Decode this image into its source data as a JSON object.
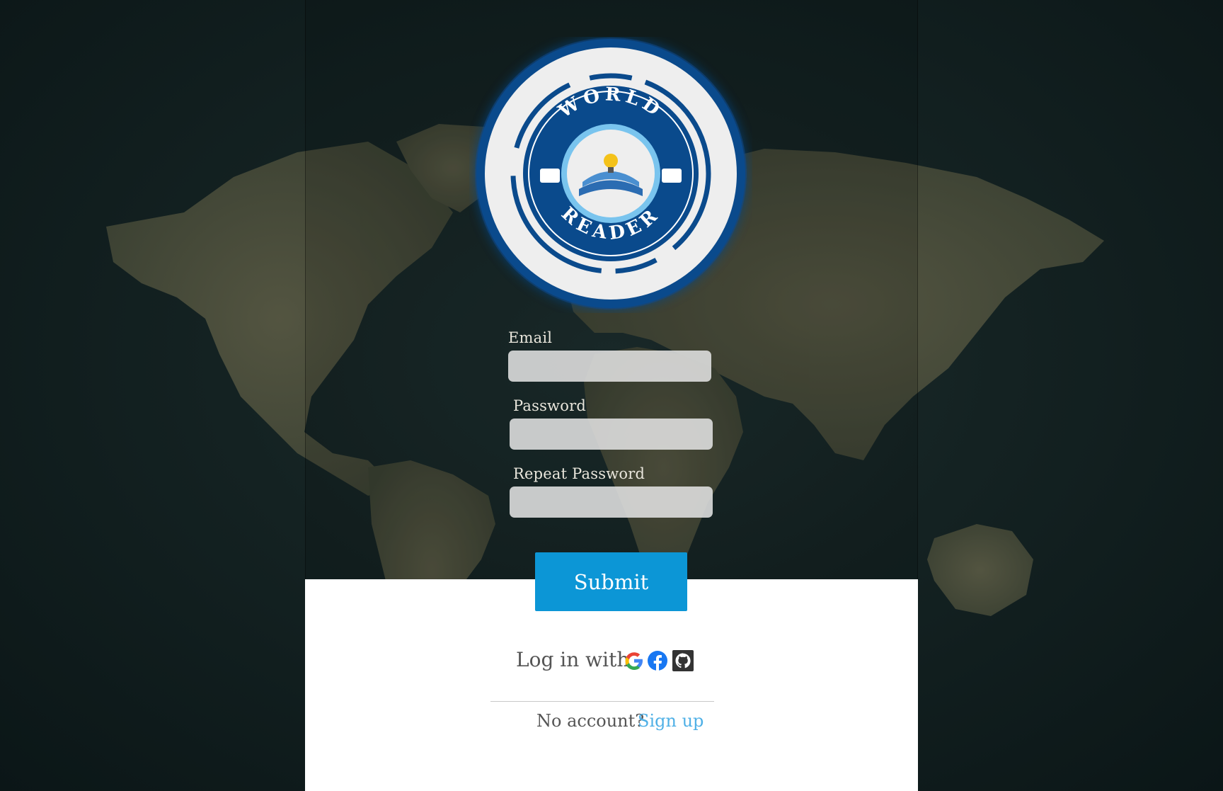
{
  "brand": {
    "logo_top_text": "WORLD",
    "logo_bottom_text": "READER",
    "accent": "#0c96d6",
    "logo_blue": "#0a4a8c"
  },
  "form": {
    "email_label": "Email",
    "email_value": "",
    "password_label": "Password",
    "password_value": "",
    "repeat_label": "Repeat Password",
    "repeat_value": "",
    "submit_label": "Submit"
  },
  "social": {
    "login_with_label": "Log in with",
    "providers": [
      "google-icon",
      "facebook-icon",
      "github-icon"
    ]
  },
  "footer": {
    "no_account": "No account?",
    "signup_label": "Sign up",
    "link_color": "#4fb0e6"
  }
}
